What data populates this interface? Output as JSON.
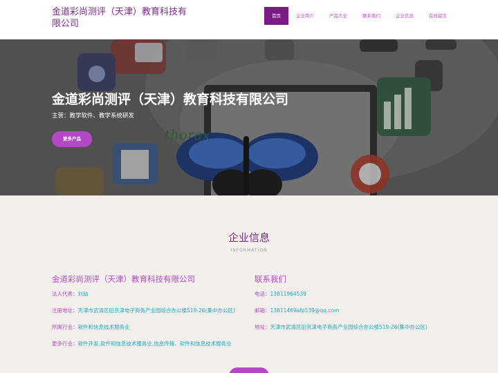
{
  "header": {
    "site_title": "金道彩尚测评（天津）教育科技有限公司",
    "nav": [
      {
        "label": "首页",
        "active": true
      },
      {
        "label": "企业简介",
        "active": false
      },
      {
        "label": "产品大全",
        "active": false
      },
      {
        "label": "联系我们",
        "active": false
      },
      {
        "label": "企业信息",
        "active": false
      },
      {
        "label": "在线留言",
        "active": false
      }
    ]
  },
  "hero": {
    "title": "金道彩尚测评（天津）教育科技有限公司",
    "subtitle": "主营：教学软件、教学系统研发",
    "button_label": "更多产品",
    "background_text": "thorax"
  },
  "info": {
    "title": "企业信息",
    "subtitle": "INFORMATION",
    "company": {
      "name": "金道彩尚测评（天津）教育科技有限公司",
      "lines": [
        {
          "key": "法人代表：",
          "value": "刘幼"
        },
        {
          "key": "注册地址：",
          "value": "天津市武清区旧京津电子商务产业园综合办公楼519-26(集中办公区)"
        },
        {
          "key": "所属行业：",
          "value": "软件和信息技术服务业"
        },
        {
          "key": "更多行业：",
          "value": "软件开发,软件和信息技术服务业,信息传输、软件和信息技术服务业"
        }
      ]
    },
    "contact": {
      "heading": "联系我们",
      "lines": [
        {
          "key": "电话：",
          "value": "13811964539"
        },
        {
          "key": "邮箱：",
          "value": "13811469afp539@qq.com"
        },
        {
          "key": "地址：",
          "value": "天津市武清区旧京津电子商务产业园综合办公楼519-26(集中办公区)"
        }
      ]
    }
  },
  "colors": {
    "brand_purple": "#7a1b88",
    "accent_purple": "#b548c6",
    "link_cyan": "#19a9c4",
    "section_bg": "#f3f0ec"
  }
}
